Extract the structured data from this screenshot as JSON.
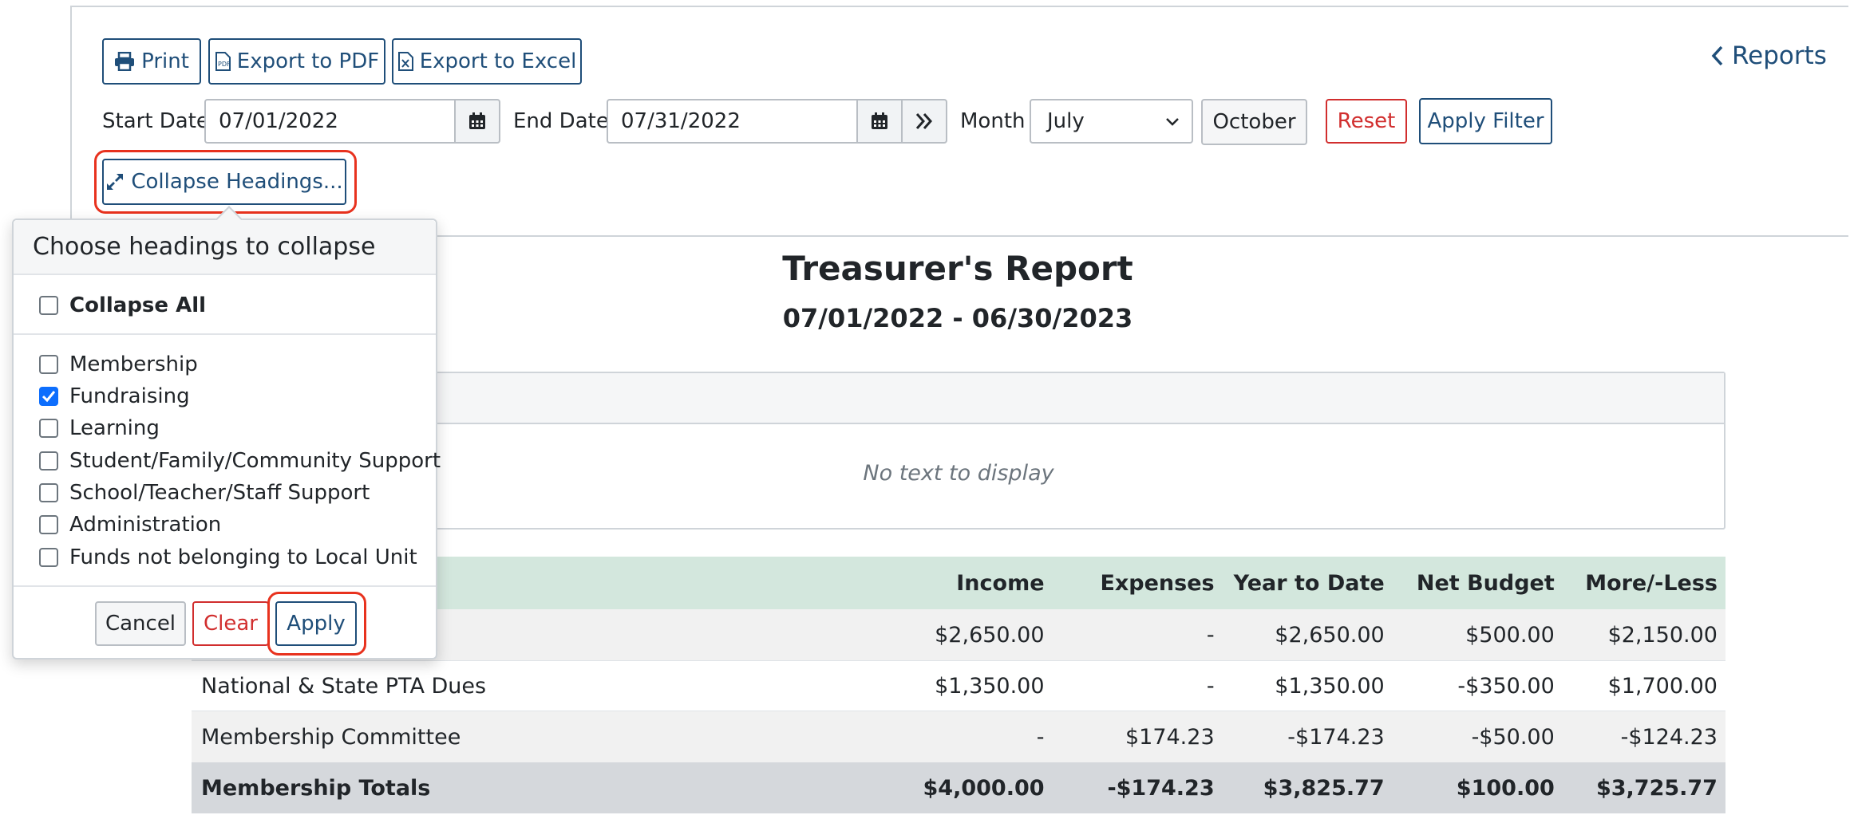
{
  "toolbar": {
    "print_label": "Print",
    "export_pdf_label": "Export to PDF",
    "export_excel_label": "Export to Excel",
    "reports_link": "Reports"
  },
  "filters": {
    "start_date_label": "Start Date",
    "start_date_value": "07/01/2022",
    "end_date_label": "End Date",
    "end_date_value": "07/31/2022",
    "month_label": "Month",
    "month_value": "July",
    "month_end_value": "October",
    "reset_label": "Reset",
    "apply_filter_label": "Apply Filter",
    "collapse_headings_label": "Collapse Headings..."
  },
  "popover": {
    "title": "Choose headings to collapse",
    "collapse_all_label": "Collapse All",
    "collapse_all_checked": false,
    "items": [
      {
        "label": "Membership",
        "checked": false
      },
      {
        "label": "Fundraising",
        "checked": true
      },
      {
        "label": "Learning",
        "checked": false
      },
      {
        "label": "Student/Family/Community Support",
        "checked": false
      },
      {
        "label": "School/Teacher/Staff Support",
        "checked": false
      },
      {
        "label": "Administration",
        "checked": false
      },
      {
        "label": "Funds not belonging to Local Unit",
        "checked": false
      }
    ],
    "cancel_label": "Cancel",
    "clear_label": "Clear",
    "apply_label": "Apply"
  },
  "report": {
    "title": "Treasurer's Report",
    "date_range": "07/01/2022 - 06/30/2023",
    "empty_text": "No text to display"
  },
  "table": {
    "headers": [
      "Income",
      "Expenses",
      "Year to Date",
      "Net Budget",
      "More/-Less"
    ],
    "rows": [
      {
        "name": "",
        "cells": [
          "$2,650.00",
          "-",
          "$2,650.00",
          "$500.00",
          "$2,150.00"
        ]
      },
      {
        "name": "National & State PTA Dues",
        "cells": [
          "$1,350.00",
          "-",
          "$1,350.00",
          "-$350.00",
          "$1,700.00"
        ]
      },
      {
        "name": "Membership Committee",
        "cells": [
          "-",
          "$174.23",
          "-$174.23",
          "-$50.00",
          "-$124.23"
        ]
      }
    ],
    "total": {
      "name": "Membership Totals",
      "cells": [
        "$4,000.00",
        "-$174.23",
        "$3,825.77",
        "$100.00",
        "$3,725.77"
      ]
    }
  },
  "colors": {
    "primary": "#1f4e79",
    "danger": "#d12e2e",
    "highlight": "#e8321e",
    "table_header": "#d3e7dd"
  }
}
